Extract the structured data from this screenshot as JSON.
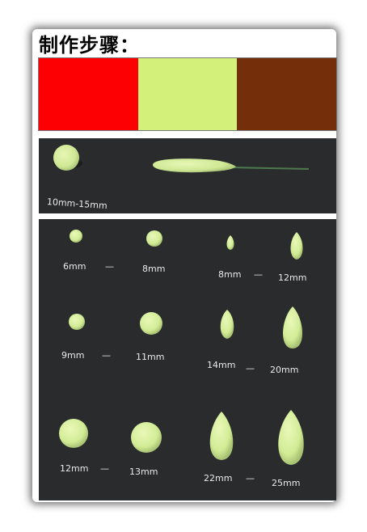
{
  "title": "制作步骤：",
  "colors": [
    {
      "name": "red",
      "hex": "#fc0004"
    },
    {
      "name": "light-green",
      "hex": "#d3f07a"
    },
    {
      "name": "brown",
      "hex": "#742e0a"
    }
  ],
  "step1": {
    "label": "10mm-15mm"
  },
  "step2": {
    "balls": [
      {
        "size": "6mm"
      },
      {
        "size": "8mm"
      },
      {
        "size": "9mm"
      },
      {
        "size": "11mm"
      },
      {
        "size": "12mm"
      },
      {
        "size": "13mm"
      }
    ],
    "cones": [
      {
        "size": "8mm"
      },
      {
        "size": "12mm"
      },
      {
        "size": "14mm"
      },
      {
        "size": "20mm"
      },
      {
        "size": "22mm"
      },
      {
        "size": "25mm"
      }
    ]
  },
  "dash": "—"
}
